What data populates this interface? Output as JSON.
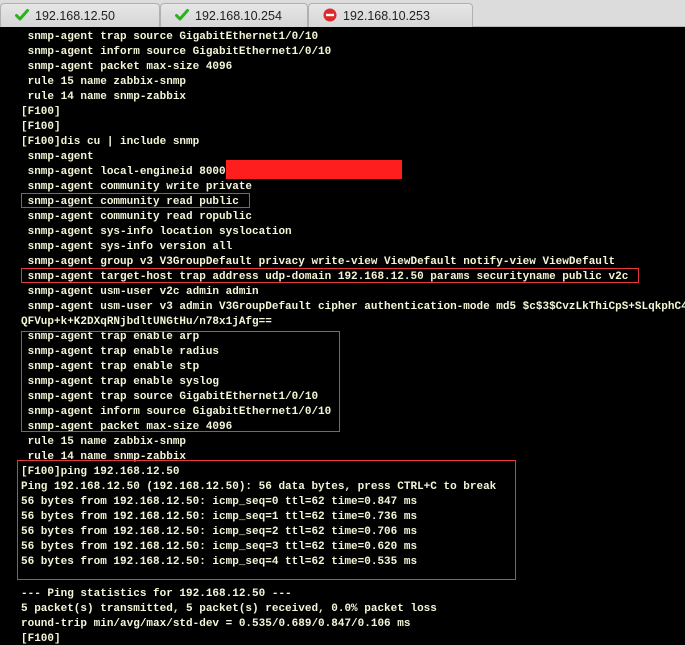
{
  "tabs": [
    {
      "label": "192.168.12.50",
      "status_icon": "check-icon",
      "color": "#2bb11f"
    },
    {
      "label": "192.168.10.254",
      "status_icon": "check-icon",
      "color": "#2bb11f"
    },
    {
      "label": "192.168.10.253",
      "status_icon": "blocked-icon",
      "color": "#e0282b"
    }
  ],
  "terminal": {
    "text_color": "#f5f5d8",
    "highlight_color": "#e8373c",
    "redaction_color": "#ff1e1e",
    "lines": [
      " snmp-agent trap source GigabitEthernet1/0/10",
      " snmp-agent inform source GigabitEthernet1/0/10",
      " snmp-agent packet max-size 4096",
      " rule 15 name zabbix-snmp",
      " rule 14 name snmp-zabbix",
      "[F100]",
      "[F100]",
      "[F100]dis cu | include snmp",
      " snmp-agent",
      " snmp-agent local-engineid 8000",
      " snmp-agent community write private",
      " snmp-agent community read public",
      " snmp-agent community read ropublic",
      " snmp-agent sys-info location syslocation",
      " snmp-agent sys-info version all",
      " snmp-agent group v3 V3GroupDefault privacy write-view ViewDefault notify-view ViewDefault",
      " snmp-agent target-host trap address udp-domain 192.168.12.50 params securityname public v2c",
      " snmp-agent usm-user v2c admin admin",
      " snmp-agent usm-user v3 admin V3GroupDefault cipher authentication-mode md5 $c$3$CvzLkThiCpS+SLqkphC4",
      "QFVup+k+K2DXqRNjbdltUNGtHu/n78x1jAfg==",
      " snmp-agent trap enable arp",
      " snmp-agent trap enable radius",
      " snmp-agent trap enable stp",
      " snmp-agent trap enable syslog",
      " snmp-agent trap source GigabitEthernet1/0/10",
      " snmp-agent inform source GigabitEthernet1/0/10",
      " snmp-agent packet max-size 4096",
      " rule 15 name zabbix-snmp",
      " rule 14 name snmp-zabbix",
      "[F100]ping 192.168.12.50",
      "Ping 192.168.12.50 (192.168.12.50): 56 data bytes, press CTRL+C to break",
      "56 bytes from 192.168.12.50: icmp_seq=0 ttl=62 time=0.847 ms",
      "56 bytes from 192.168.12.50: icmp_seq=1 ttl=62 time=0.736 ms",
      "56 bytes from 192.168.12.50: icmp_seq=2 ttl=62 time=0.706 ms",
      "56 bytes from 192.168.12.50: icmp_seq=3 ttl=62 time=0.620 ms",
      "56 bytes from 192.168.12.50: icmp_seq=4 ttl=62 time=0.535 ms",
      "",
      "--- Ping statistics for 192.168.12.50 ---",
      "5 packet(s) transmitted, 5 packet(s) received, 0.0% packet loss",
      "round-trip min/avg/max/std-dev = 0.535/0.689/0.847/0.106 ms",
      "[F100]"
    ]
  }
}
